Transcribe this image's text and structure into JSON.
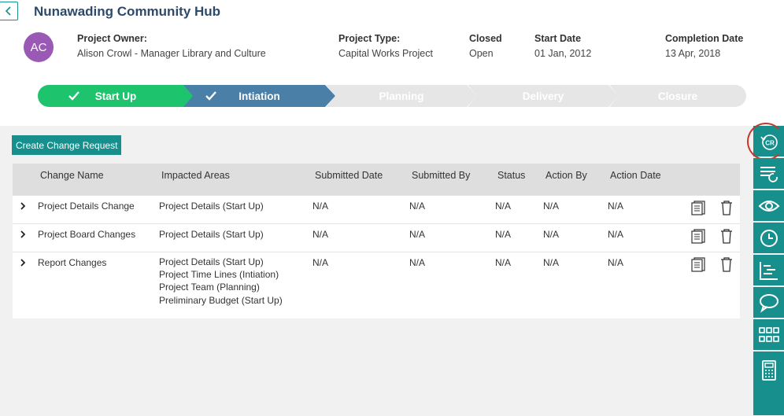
{
  "header": {
    "title": "Nunawading Community Hub",
    "avatar_initials": "AC",
    "avatar_color": "#9b59b6",
    "owner_label": "Project Owner:",
    "owner_value": "Alison Crowl - Manager Library and Culture",
    "type_label": "Project Type:",
    "type_value": "Capital Works Project",
    "closed_label": "Closed",
    "closed_value": "Open",
    "start_label": "Start Date",
    "start_value": "01 Jan, 2012",
    "completion_label": "Completion Date",
    "completion_value": "13 Apr, 2018"
  },
  "stepper": {
    "steps": [
      {
        "label": "Start Up",
        "state": "done",
        "color": "#1ec46d"
      },
      {
        "label": "Intiation",
        "state": "done",
        "color": "#4a7fa8"
      },
      {
        "label": "Planning",
        "state": "pending",
        "color": "#e6e6e6"
      },
      {
        "label": "Delivery",
        "state": "pending",
        "color": "#e6e6e6"
      },
      {
        "label": "Closure",
        "state": "pending",
        "color": "#e6e6e6"
      }
    ]
  },
  "actions": {
    "create_label": "Create Change Request"
  },
  "table": {
    "columns": [
      "Change Name",
      "Impacted Areas",
      "Submitted Date",
      "Submitted By",
      "Status",
      "Action By",
      "Action Date"
    ],
    "rows": [
      {
        "name": "Project Details Change",
        "areas": [
          "Project Details (Start Up)"
        ],
        "submitted_date": "N/A",
        "submitted_by": "N/A",
        "status": "N/A",
        "action_by": "N/A",
        "action_date": "N/A"
      },
      {
        "name": "Project Board Changes",
        "areas": [
          "Project Details (Start Up)"
        ],
        "submitted_date": "N/A",
        "submitted_by": "N/A",
        "status": "N/A",
        "action_by": "N/A",
        "action_date": "N/A"
      },
      {
        "name": "Report Changes",
        "areas": [
          "Project Details (Start Up)",
          "Project Time Lines (Intiation)",
          "Project Team (Planning)",
          "Preliminary Budget (Start Up)"
        ],
        "submitted_date": "N/A",
        "submitted_by": "N/A",
        "status": "N/A",
        "action_by": "N/A",
        "action_date": "N/A"
      }
    ]
  },
  "sidebar": {
    "accent": "#178f8c",
    "items": [
      "change-request-icon",
      "list-refresh-icon",
      "eye-icon",
      "clock-icon",
      "gantt-icon",
      "chat-icon",
      "grid-icon",
      "calculator-icon"
    ],
    "active_badge_text": "CR"
  }
}
